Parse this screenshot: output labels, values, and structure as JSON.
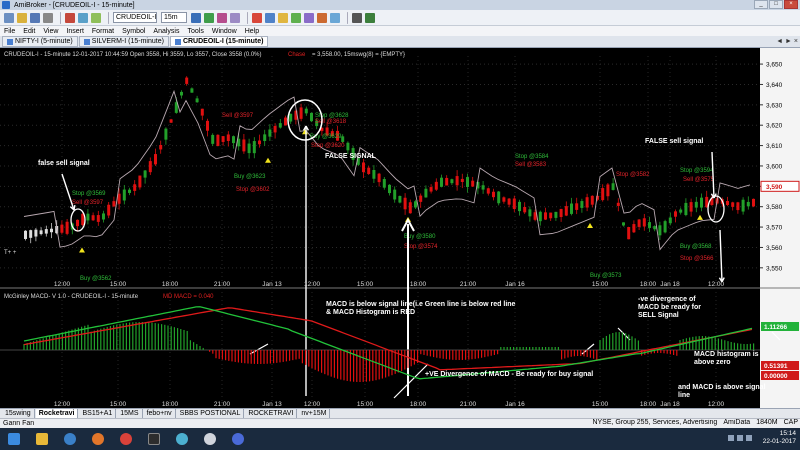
{
  "window": {
    "title": "AmiBroker - [CRUDEOIL-I - 15-minute]"
  },
  "toolbar": {
    "symbol": "CRUDEOIL-I",
    "interval": "15m"
  },
  "menu": [
    "File",
    "Edit",
    "View",
    "Insert",
    "Format",
    "Symbol",
    "Analysis",
    "Tools",
    "Window",
    "Help"
  ],
  "chart_tabs": [
    {
      "label": "NIFTY-I (5-minute)",
      "active": false
    },
    {
      "label": "SILVERM-I (15-minute)",
      "active": false
    },
    {
      "label": "CRUDEOIL-I (15-minute)",
      "active": true
    }
  ],
  "price_pane": {
    "header": "CRUDEOIL-I - 15-minute 12-01-2017 10:44:59 Open 3558, Hi 3559, Lo 3557, Close 3558 (0.0%)",
    "header_red": "Chase",
    "header_tail": "= 3,558.00, 15mswg(8) = {EMPTY}",
    "last_price": "3,590",
    "y_ticks": [
      "3,650",
      "3,640",
      "3,630",
      "3,620",
      "3,610",
      "3,600",
      "3,590",
      "3,580",
      "3,570",
      "3,560",
      "3,550"
    ]
  },
  "macd_pane": {
    "header": "McGinley MACD- V 1.0 - CRUDEOIL-I - 15-minute",
    "header_red": "MD MACD = 0.040",
    "value_green": "1.11266",
    "value_red1": "0.51391",
    "value_red2": "0.00000"
  },
  "x_axis": [
    {
      "label": "12:00",
      "pos": 62
    },
    {
      "label": "15:00",
      "pos": 118
    },
    {
      "label": "18:00",
      "pos": 170
    },
    {
      "label": "21:00",
      "pos": 222
    },
    {
      "label": "Jan 13",
      "pos": 272
    },
    {
      "label": "12:00",
      "pos": 312
    },
    {
      "label": "15:00",
      "pos": 365
    },
    {
      "label": "18:00",
      "pos": 418
    },
    {
      "label": "21:00",
      "pos": 468
    },
    {
      "label": "Jan 16",
      "pos": 515
    },
    {
      "label": "15:00",
      "pos": 600
    },
    {
      "label": "18:00",
      "pos": 648
    },
    {
      "label": "Jan 18",
      "pos": 670
    },
    {
      "label": "12:00",
      "pos": 716
    }
  ],
  "signals": [
    {
      "text": "Stop @3569",
      "kind": "stop"
    },
    {
      "text": "Sell @3597",
      "kind": "sell"
    },
    {
      "text": "Buy @3562",
      "kind": "buy"
    },
    {
      "text": "Sell @3597",
      "kind": "sell"
    },
    {
      "text": "Buy @3623",
      "kind": "buy"
    },
    {
      "text": "Stop @3602",
      "kind": "sell"
    },
    {
      "text": "Stop @3628",
      "kind": "stop"
    },
    {
      "text": "Sell @3618",
      "kind": "sell"
    },
    {
      "text": "Buy @3629",
      "kind": "buy"
    },
    {
      "text": "Stop @3620",
      "kind": "sell"
    },
    {
      "text": "Buy @3580",
      "kind": "buy"
    },
    {
      "text": "Stop @3574",
      "kind": "sell"
    },
    {
      "text": "Stop @3584",
      "kind": "stop"
    },
    {
      "text": "Sell @3583",
      "kind": "sell"
    },
    {
      "text": "Stop @3582",
      "kind": "sell"
    },
    {
      "text": "Buy @3573",
      "kind": "buy"
    },
    {
      "text": "Stop @3594",
      "kind": "stop"
    },
    {
      "text": "Sell @3575",
      "kind": "sell"
    },
    {
      "text": "Buy @3568",
      "kind": "buy"
    },
    {
      "text": "Stop @3566",
      "kind": "sell"
    }
  ],
  "annotations": {
    "false_sell_left": "false sell signal",
    "false_signal_mid": "FALSE SIGNAL",
    "false_sell_right": "FALSE sell signal",
    "macd_below": "MACD is below signal line(i.e Green line is below red line  & MACD Histogram is RED",
    "ve_div_neg": "-ve divergence of MACD be ready for SELL Signal",
    "macd_hist_above": "MACD histogram is above zero",
    "macd_above": "and MACD is above signal line",
    "ve_div_pos": "+VE Divergence of MACD - Be ready for buy signal"
  },
  "sheet_tabs": [
    "15swing",
    "Rocketravi",
    "BS15+A1",
    "15MS",
    "febo+nv",
    "SBBS POSTIONAL",
    "ROCKETRAVI",
    "nv+15M"
  ],
  "active_sheet": "Rocketravi",
  "status": {
    "left": "Gann Fan",
    "market": "NYSE, Group 255, Services, Advertising",
    "db": "AmiData",
    "mem": "1840M",
    "cap": "CAP"
  },
  "taskbar": {
    "time": "15:14",
    "date": "22-01-2017"
  },
  "colors": {
    "bg": "#000000",
    "bull": "#22a02a",
    "bear": "#e01010",
    "macd": "#22c23a",
    "signal": "#e01a1a",
    "stopline": "#b8a8b0"
  }
}
